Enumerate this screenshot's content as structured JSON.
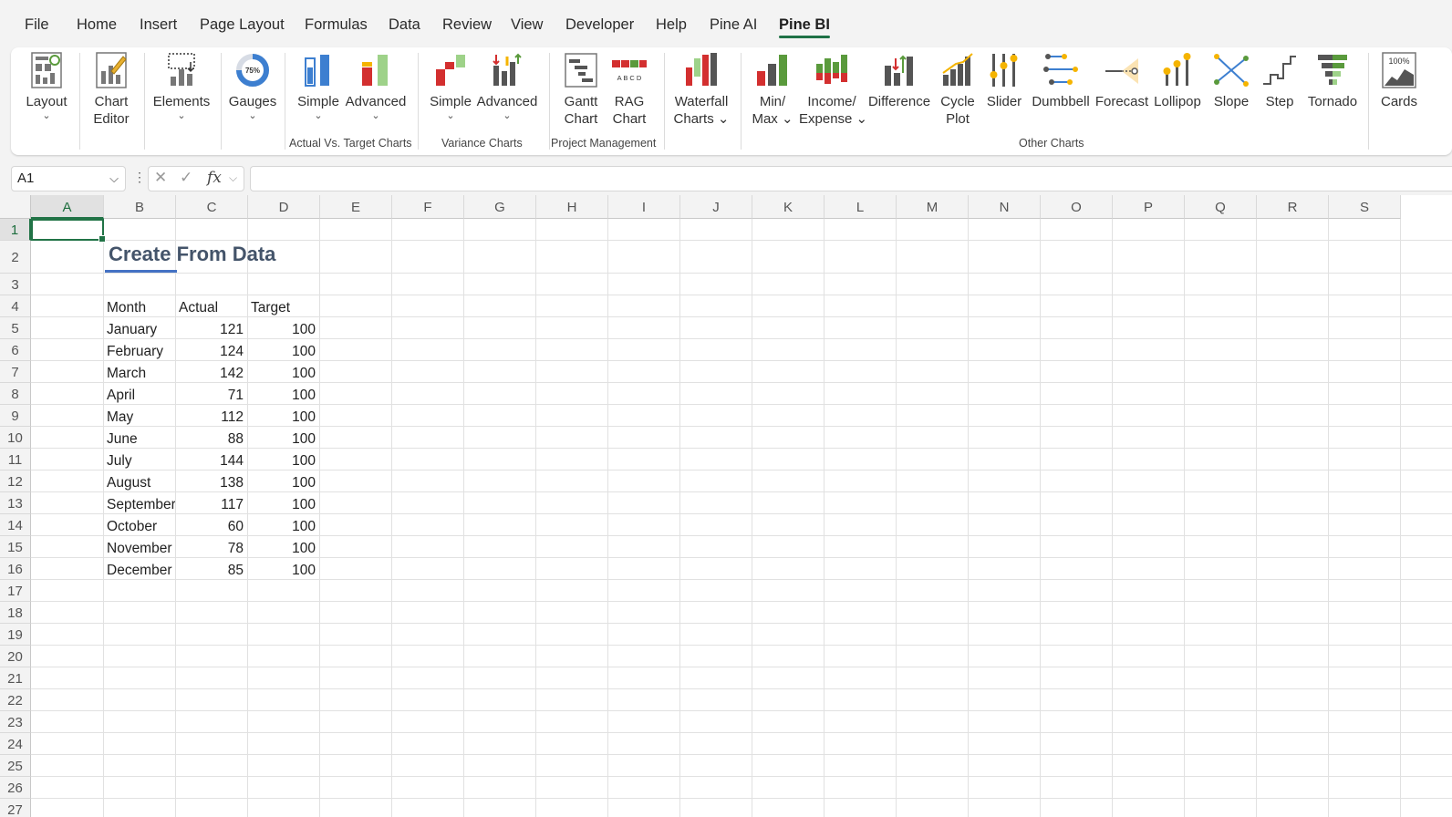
{
  "menu": [
    "File",
    "Home",
    "Insert",
    "Page Layout",
    "Formulas",
    "Data",
    "Review",
    "View",
    "Developer",
    "Help",
    "Pine AI",
    "Pine BI"
  ],
  "active_menu": "Pine BI",
  "ribbon": {
    "buttons": [
      {
        "id": "layout",
        "line1": "Layout",
        "line2": "",
        "chevron": "⌄"
      },
      {
        "id": "chart-editor",
        "line1": "Chart",
        "line2": "Editor",
        "chevron": ""
      },
      {
        "id": "elements",
        "line1": "Elements",
        "line2": "",
        "chevron": "⌄"
      },
      {
        "id": "gauges",
        "line1": "Gauges",
        "line2": "",
        "chevron": "⌄",
        "icon_text": "75%"
      },
      {
        "id": "avt-simple",
        "line1": "Simple",
        "line2": "",
        "chevron": "⌄"
      },
      {
        "id": "avt-advanced",
        "line1": "Advanced",
        "line2": "",
        "chevron": "⌄"
      },
      {
        "id": "var-simple",
        "line1": "Simple",
        "line2": "",
        "chevron": "⌄"
      },
      {
        "id": "var-advanced",
        "line1": "Advanced",
        "line2": "",
        "chevron": "⌄"
      },
      {
        "id": "gantt",
        "line1": "Gantt",
        "line2": "Chart",
        "chevron": ""
      },
      {
        "id": "rag",
        "line1": "RAG",
        "line2": "Chart",
        "chevron": "",
        "icon_text": "A B C D"
      },
      {
        "id": "waterfall",
        "line1": "Waterfall",
        "line2": "Charts ⌄",
        "chevron": ""
      },
      {
        "id": "minmax",
        "line1": "Min/",
        "line2": "Max ⌄",
        "chevron": ""
      },
      {
        "id": "income",
        "line1": "Income/",
        "line2": "Expense ⌄",
        "chevron": ""
      },
      {
        "id": "difference",
        "line1": "Difference",
        "line2": "",
        "chevron": ""
      },
      {
        "id": "cycle",
        "line1": "Cycle",
        "line2": "Plot",
        "chevron": ""
      },
      {
        "id": "slider",
        "line1": "Slider",
        "line2": "",
        "chevron": ""
      },
      {
        "id": "dumbbell",
        "line1": "Dumbbell",
        "line2": "",
        "chevron": ""
      },
      {
        "id": "forecast",
        "line1": "Forecast",
        "line2": "",
        "chevron": ""
      },
      {
        "id": "lollipop",
        "line1": "Lollipop",
        "line2": "",
        "chevron": ""
      },
      {
        "id": "slope",
        "line1": "Slope",
        "line2": "",
        "chevron": ""
      },
      {
        "id": "step",
        "line1": "Step",
        "line2": "",
        "chevron": ""
      },
      {
        "id": "tornado",
        "line1": "Tornado",
        "line2": "",
        "chevron": ""
      },
      {
        "id": "cards",
        "line1": "Cards",
        "line2": "",
        "chevron": "",
        "icon_text": "100%"
      }
    ],
    "groups": [
      "Actual Vs. Target Charts",
      "Variance Charts",
      "Project Management",
      "Other Charts"
    ]
  },
  "formula_bar": {
    "name_box": "A1",
    "value": ""
  },
  "columns": [
    "A",
    "B",
    "C",
    "D",
    "E",
    "F",
    "G",
    "H",
    "I",
    "J",
    "K",
    "L",
    "M",
    "N",
    "O",
    "P",
    "Q",
    "R",
    "S"
  ],
  "rows": [
    "1",
    "2",
    "3",
    "4",
    "5",
    "6",
    "7",
    "8",
    "9",
    "10",
    "11",
    "12",
    "13",
    "14",
    "15",
    "16",
    "17",
    "18",
    "19",
    "20",
    "21",
    "22",
    "23",
    "24",
    "25",
    "26",
    "27"
  ],
  "sheet": {
    "title": "Create From Data",
    "headers": [
      "Month",
      "Actual",
      "Target"
    ],
    "data": [
      [
        "January",
        "121",
        "100"
      ],
      [
        "February",
        "124",
        "100"
      ],
      [
        "March",
        "142",
        "100"
      ],
      [
        "April",
        "71",
        "100"
      ],
      [
        "May",
        "112",
        "100"
      ],
      [
        "June",
        "88",
        "100"
      ],
      [
        "July",
        "144",
        "100"
      ],
      [
        "August",
        "138",
        "100"
      ],
      [
        "September",
        "117",
        "100"
      ],
      [
        "October",
        "60",
        "100"
      ],
      [
        "November",
        "78",
        "100"
      ],
      [
        "December",
        "85",
        "100"
      ]
    ]
  }
}
